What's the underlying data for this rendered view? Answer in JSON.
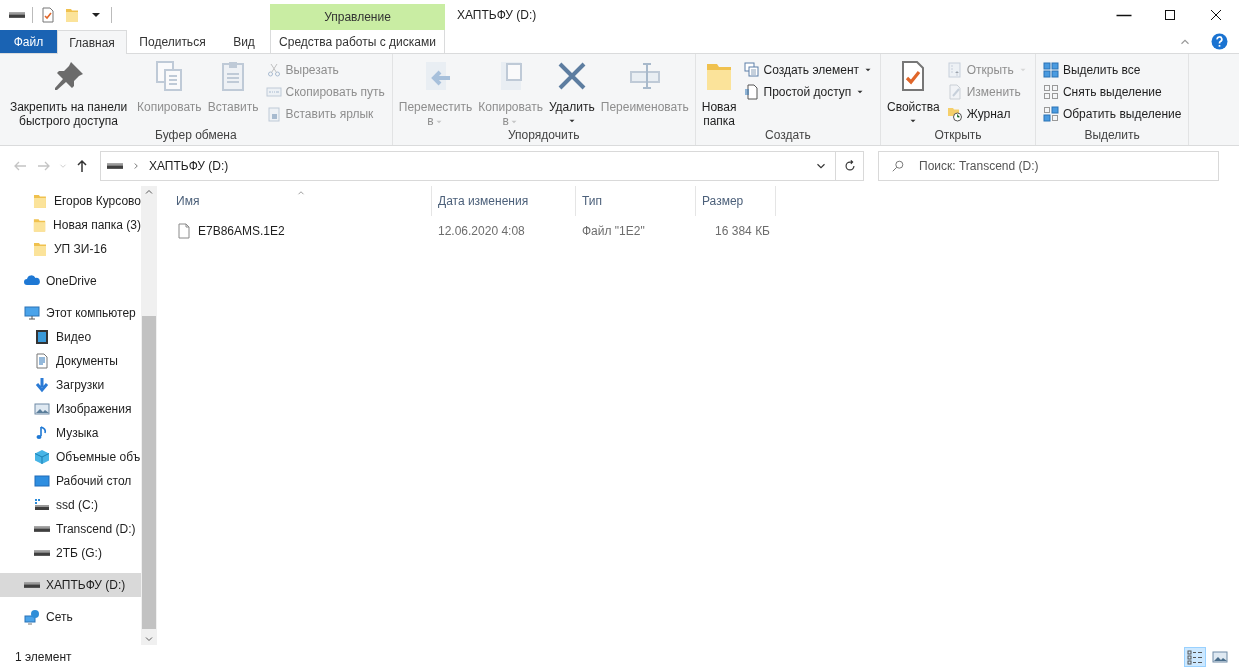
{
  "window": {
    "title": "ХАПТЬФУ (D:)",
    "context_label": "Управление"
  },
  "quick_access_toolbar": [
    {
      "kind": "drive"
    },
    {
      "kind": "properties"
    },
    {
      "kind": "folder"
    },
    {
      "kind": "dropdown"
    }
  ],
  "tabs": [
    {
      "label": "Файл",
      "kind": "file",
      "selected": false
    },
    {
      "label": "Главная",
      "kind": "plain",
      "selected": true
    },
    {
      "label": "Поделиться",
      "kind": "plain",
      "selected": false
    },
    {
      "label": "Вид",
      "kind": "plain",
      "selected": false
    },
    {
      "label": "Средства работы с дисками",
      "kind": "context",
      "selected": false
    }
  ],
  "ribbon_groups": [
    {
      "label": "Буфер обмена",
      "items": [
        {
          "kind": "large",
          "label": "Закрепить на панели быстрого доступа",
          "disabled": false,
          "dropdown": false
        },
        {
          "kind": "large",
          "label": "Копировать",
          "disabled": true,
          "dropdown": false
        },
        {
          "kind": "large",
          "label": "Вставить",
          "disabled": true,
          "dropdown": false
        },
        {
          "kind": "small",
          "label": "Вырезать",
          "disabled": true,
          "dropdown": false
        },
        {
          "kind": "small",
          "label": "Скопировать путь",
          "disabled": true,
          "dropdown": false
        },
        {
          "kind": "small",
          "label": "Вставить ярлык",
          "disabled": true,
          "dropdown": false
        }
      ]
    },
    {
      "label": "Упорядочить",
      "items": [
        {
          "kind": "large",
          "label": "Переместить в",
          "disabled": true,
          "dropdown": true
        },
        {
          "kind": "large",
          "label": "Копировать в",
          "disabled": true,
          "dropdown": true
        },
        {
          "kind": "large",
          "label": "Удалить",
          "disabled": false,
          "dropdown": true
        },
        {
          "kind": "large",
          "label": "Переименовать",
          "disabled": true,
          "dropdown": false
        }
      ]
    },
    {
      "label": "Создать",
      "items": [
        {
          "kind": "large",
          "label": "Новая папка",
          "disabled": false,
          "dropdown": false
        },
        {
          "kind": "small",
          "label": "Создать элемент",
          "disabled": false,
          "dropdown": true
        },
        {
          "kind": "small",
          "label": "Простой доступ",
          "disabled": false,
          "dropdown": true
        }
      ]
    },
    {
      "label": "Открыть",
      "items": [
        {
          "kind": "large",
          "label": "Свойства",
          "disabled": false,
          "dropdown": true
        },
        {
          "kind": "small",
          "label": "Открыть",
          "disabled": true,
          "dropdown": true
        },
        {
          "kind": "small",
          "label": "Изменить",
          "disabled": true,
          "dropdown": false
        },
        {
          "kind": "small",
          "label": "Журнал",
          "disabled": false,
          "dropdown": false
        }
      ]
    },
    {
      "label": "Выделить",
      "items": [
        {
          "kind": "small",
          "label": "Выделить все",
          "disabled": false,
          "dropdown": false
        },
        {
          "kind": "small",
          "label": "Снять выделение",
          "disabled": false,
          "dropdown": false
        },
        {
          "kind": "small",
          "label": "Обратить выделение",
          "disabled": false,
          "dropdown": false
        }
      ]
    }
  ],
  "nav_buttons": [
    {
      "disabled": true
    },
    {
      "disabled": true
    },
    {
      "disabled": true
    },
    {
      "disabled": false
    }
  ],
  "address_bar": {
    "path": "ХАПТЬФУ (D:)"
  },
  "search": {
    "placeholder": "Поиск: Transcend (D:)"
  },
  "navigation_pane": {
    "quick_access_items": [
      {
        "label": "Егоров Курсово",
        "selected": false
      },
      {
        "label": "Новая папка (3)",
        "selected": false
      },
      {
        "label": "УП ЗИ-16",
        "selected": false
      }
    ],
    "items": [
      {
        "label": "OneDrive",
        "selected": false
      },
      {
        "label": "Этот компьютер",
        "selected": false,
        "children": [
          {
            "label": "Видео",
            "selected": false
          },
          {
            "label": "Документы",
            "selected": false
          },
          {
            "label": "Загрузки",
            "selected": false
          },
          {
            "label": "Изображения",
            "selected": false
          },
          {
            "label": "Музыка",
            "selected": false
          },
          {
            "label": "Объемные объ",
            "selected": false
          },
          {
            "label": "Рабочий стол",
            "selected": false
          },
          {
            "label": "ssd (C:)",
            "selected": false
          },
          {
            "label": "Transcend (D:)",
            "selected": false
          },
          {
            "label": "2ТБ (G:)",
            "selected": false
          }
        ]
      },
      {
        "label": "ХАПТЬФУ (D:)",
        "selected": true
      },
      {
        "label": "Сеть",
        "selected": false
      }
    ]
  },
  "file_list": {
    "columns": [
      {
        "label": "Имя",
        "sorted": true
      },
      {
        "label": "Дата изменения",
        "sorted": false
      },
      {
        "label": "Тип",
        "sorted": false
      },
      {
        "label": "Размер",
        "sorted": false
      }
    ],
    "rows": [
      {
        "cells": [
          "E7B86AMS.1E2",
          "12.06.2020 4:08",
          "Файл \"1E2\"",
          "16 384 КБ"
        ]
      }
    ]
  },
  "status_bar": {
    "text": "1 элемент",
    "views": [
      {
        "selected": true
      },
      {
        "selected": false
      }
    ]
  }
}
